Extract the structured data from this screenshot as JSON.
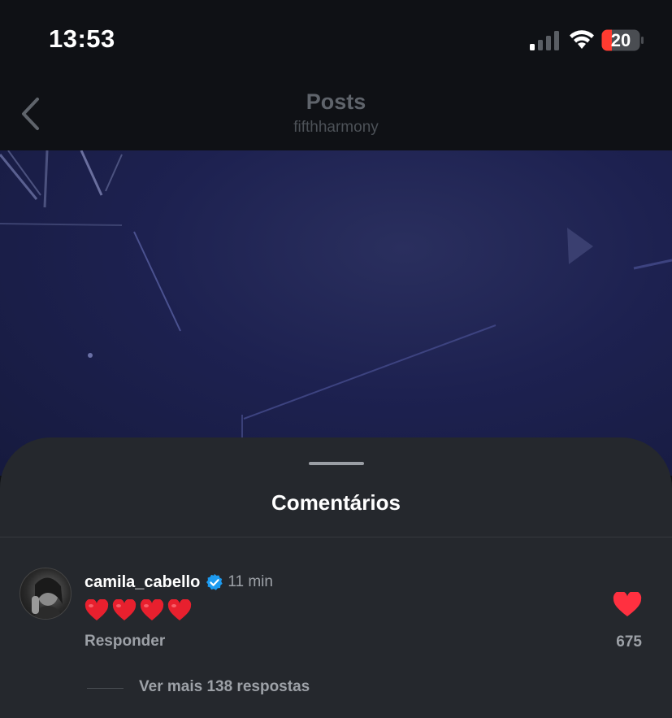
{
  "status_bar": {
    "time": "13:53",
    "battery": "20",
    "signal_icon": "cellular-signal-icon",
    "wifi_icon": "wifi-icon",
    "battery_icon": "battery-low-icon"
  },
  "nav": {
    "title": "Posts",
    "subtitle": "fifthharmony",
    "back_icon": "chevron-left-icon"
  },
  "sheet": {
    "title": "Comentários",
    "comment": {
      "username": "camila_cabello",
      "verified_icon": "verified-badge-icon",
      "timestamp": "11 min",
      "text_emojis": [
        "❤️",
        "❤️",
        "❤️",
        "❤️"
      ],
      "reply_label": "Responder",
      "like_count": "675",
      "liked": true,
      "like_color": "#ff3040",
      "view_replies_label": "Ver mais 138 respostas"
    }
  },
  "colors": {
    "background": "#0f1115",
    "sheet": "#25282d",
    "verified": "#1d9bf0",
    "muted_text": "#9da1a7"
  }
}
